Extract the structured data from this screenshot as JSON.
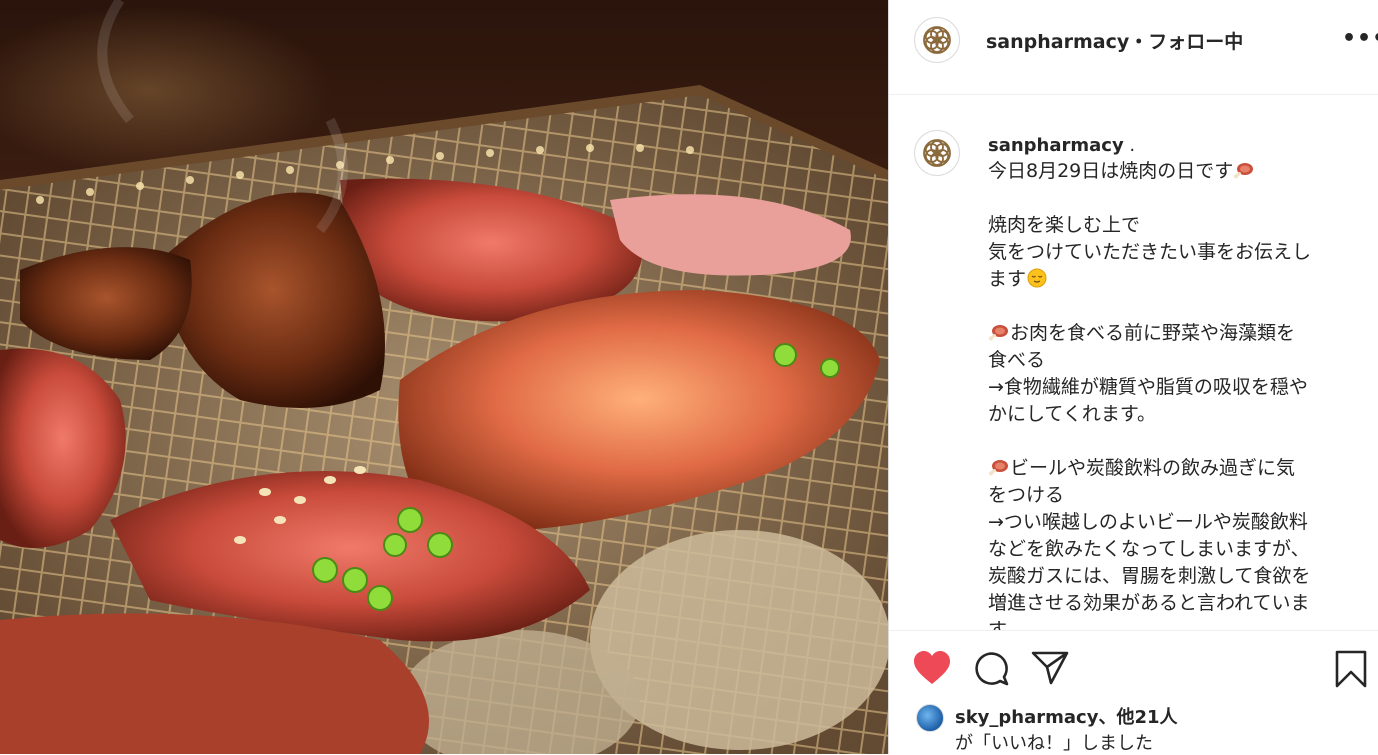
{
  "post": {
    "photo_alt": "焼肉の写真",
    "header": {
      "username": "sanpharmacy",
      "separator": "・",
      "follow_status": "フォロー中",
      "menu_icon": "more-dots-icon",
      "more_label": "•••"
    },
    "caption": {
      "author": "sanpharmacy",
      "author_suffix": " .",
      "lines": [
        {
          "text": "今日8月29日は焼肉の日です",
          "emoji_after": "meat-emoji"
        },
        {
          "text": ""
        },
        {
          "text": "焼肉を楽しむ上で"
        },
        {
          "text": "気をつけていただきたい事をお伝えし"
        },
        {
          "text": "ます",
          "emoji_after": "relieved-face-emoji"
        },
        {
          "text": ""
        },
        {
          "text": "お肉を食べる前に野菜や海藻類を",
          "emoji_before": "meat-emoji"
        },
        {
          "text": "食べる"
        },
        {
          "text": "→食物繊維が糖質や脂質の吸収を穏や"
        },
        {
          "text": "かにしてくれます。"
        },
        {
          "text": ""
        },
        {
          "text": "ビールや炭酸飲料の飲み過ぎに気",
          "emoji_before": "meat-emoji"
        },
        {
          "text": "をつける"
        },
        {
          "text": "→つい喉越しのよいビールや炭酸飲料"
        },
        {
          "text": "などを飲みたくなってしまいますが、"
        },
        {
          "text": "炭酸ガスには、胃腸を刺激して食欲を"
        },
        {
          "text": "増進させる効果があると言われていま"
        },
        {
          "text": "す。"
        }
      ]
    },
    "actions": {
      "like_icon": "heart-icon-filled",
      "comment_icon": "comment-icon",
      "share_icon": "share-icon",
      "save_icon": "bookmark-icon",
      "like_color": "#ed4956"
    },
    "likes": {
      "liker": "sky_pharmacy",
      "others": "、他21人",
      "suffix": "が「いいね！」しました"
    }
  }
}
